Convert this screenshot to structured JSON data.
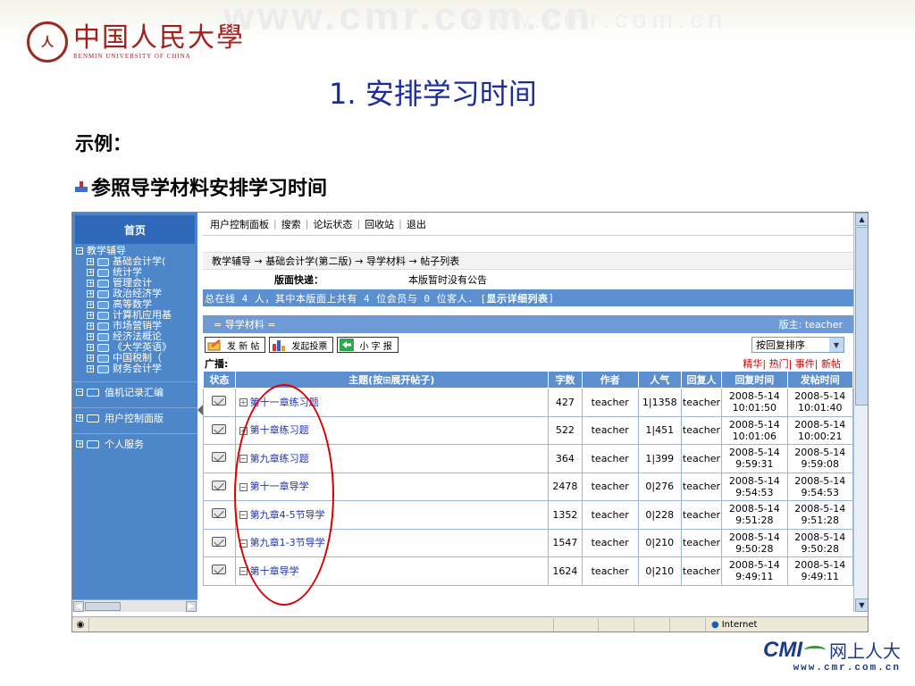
{
  "slide": {
    "watermark": "www.cmr.com.cn",
    "logo_cn": "中国人民大學",
    "logo_en": "RENMIN UNIVERSITY OF CHINA",
    "title": "1. 安排学习时间",
    "example": "示例：",
    "bullet_text": "参照导学材料安排学习时间",
    "footer_brand": "CMI",
    "footer_cn": "网上人大",
    "footer_url": "www.cmr.com.cn"
  },
  "sidebar": {
    "home": "首页",
    "root": "教学辅导",
    "items": [
      "基础会计学(",
      "统计学",
      "管理会计",
      "政治经济学",
      "高等数学",
      "计算机应用基",
      "市场营销学",
      "经济法概论",
      "《大学英语》",
      "中国税制（",
      "财务会计学"
    ],
    "sections": [
      "值机记录汇编",
      "用户控制面版",
      "个人服务"
    ]
  },
  "topnav": [
    "用户控制面板",
    "搜索",
    "论坛状态",
    "回收站",
    "退出"
  ],
  "breadcrumb": "教学辅导 → 基础会计学(第二版) → 导学材料 → 帖子列表",
  "announce": {
    "label": "版面快递：",
    "text": "本版暂时没有公告"
  },
  "online": {
    "text": "总在线 4 人，其中本版面上共有 4 位会员与 0 位客人. [",
    "detail": "显示详细列表",
    "close": "]"
  },
  "board": {
    "name": "= 导学材料 =",
    "moderator": "版主: teacher"
  },
  "toolbar": {
    "new_post": "发 新 帖",
    "new_vote": "发起投票",
    "small_report": "小 字 报",
    "sort": "按回复排序"
  },
  "broadcast": {
    "label": "广播:",
    "links": "精华| 热门| 事件| 新帖"
  },
  "table": {
    "headers": [
      "状态",
      "主题(按⊞展开帖子)",
      "字数",
      "作者",
      "人气",
      "回复人",
      "回复时间",
      "发帖时间"
    ],
    "rows": [
      {
        "subject": "第十一章练习题",
        "words": "427",
        "author": "teacher",
        "pop": "1|1358",
        "replier": "teacher",
        "reply_time": "2008-5-14 10:01:50",
        "post_time": "2008-5-14 10:01:40"
      },
      {
        "subject": "第十章练习题",
        "words": "522",
        "author": "teacher",
        "pop": "1|451",
        "replier": "teacher",
        "reply_time": "2008-5-14 10:01:06",
        "post_time": "2008-5-14 10:00:21"
      },
      {
        "subject": "第九章练习题",
        "words": "364",
        "author": "teacher",
        "pop": "1|399",
        "replier": "teacher",
        "reply_time": "2008-5-14 9:59:31",
        "post_time": "2008-5-14 9:59:08"
      },
      {
        "subject": "第十一章导学",
        "words": "2478",
        "author": "teacher",
        "pop": "0|276",
        "replier": "teacher",
        "reply_time": "2008-5-14 9:54:53",
        "post_time": "2008-5-14 9:54:53"
      },
      {
        "subject": "第九章4-5节导学",
        "words": "1352",
        "author": "teacher",
        "pop": "0|228",
        "replier": "teacher",
        "reply_time": "2008-5-14 9:51:28",
        "post_time": "2008-5-14 9:51:28"
      },
      {
        "subject": "第九章1-3节导学",
        "words": "1547",
        "author": "teacher",
        "pop": "0|210",
        "replier": "teacher",
        "reply_time": "2008-5-14 9:50:28",
        "post_time": "2008-5-14 9:50:28"
      },
      {
        "subject": "第十章导学",
        "words": "1624",
        "author": "teacher",
        "pop": "0|210",
        "replier": "teacher",
        "reply_time": "2008-5-14 9:49:11",
        "post_time": "2008-5-14 9:49:11"
      }
    ]
  },
  "statusbar": {
    "zone": "Internet"
  },
  "colors": {
    "title": "#1a2ba0",
    "sidebar": "#4d87c9",
    "header": "#5b8fd0",
    "highlight_ellipse": "#dd0000"
  }
}
